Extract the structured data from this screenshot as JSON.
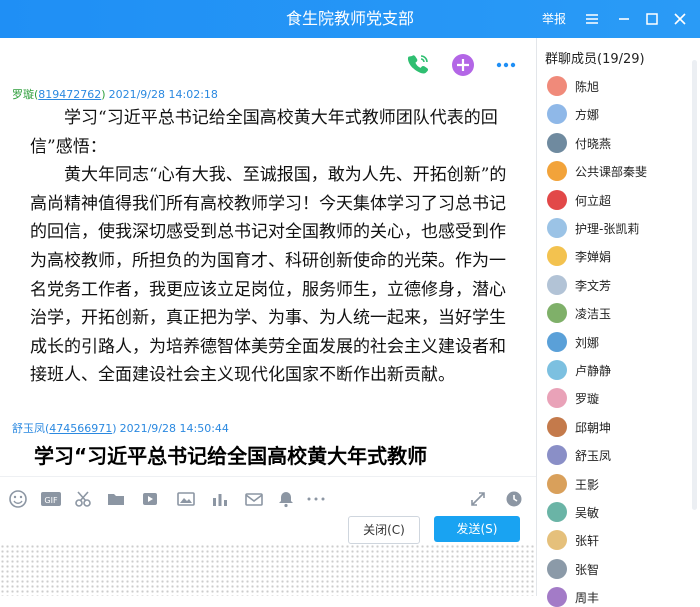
{
  "window": {
    "title": "食生院教师党支部",
    "report_label": "举报"
  },
  "messages": [
    {
      "sender": "罗璇",
      "qq": "819472762",
      "time": "2021/9/28 14:02:18",
      "paragraphs": [
        "学习“习近平总书记给全国高校黄大年式教师团队代表的回信”感悟：",
        "黄大年同志“心有大我、至诚报国，敢为人先、开拓创新”的高尚精神值得我们所有高校教师学习！今天集体学习了习总书记的回信，使我深切感受到总书记对全国教师的关心，也感受到作为高校教师，所担负的为国育才、科研创新使命的光荣。作为一名党务工作者，我更应该立足岗位，服务师生，立德修身，潜心治学，开拓创新，真正把为学、为事、为人统一起来，当好学生成长的引路人，为培养德智体美劳全面发展的社会主义建设者和接班人、全面建设社会主义现代化国家不断作出新贡献。"
      ]
    },
    {
      "sender": "舒玉凤",
      "qq": "474566971",
      "time": "2021/9/28 14:50:44",
      "preview": "学习“习近平总书记给全国高校黄大年式教师"
    }
  ],
  "buttons": {
    "close": "关闭(C)",
    "send": "发送(S)"
  },
  "members": {
    "title": "群聊成员(19/29)",
    "list": [
      "陈旭",
      "方娜",
      "付晓燕",
      "公共课部秦斐",
      "何立超",
      "护理-张凯莉",
      "李婵娟",
      "李文芳",
      "凌洁玉",
      "刘娜",
      "卢静静",
      "罗璇",
      "邱朝坤",
      "舒玉凤",
      "王影",
      "吴敏",
      "张轩",
      "张智",
      "周丰"
    ],
    "avatar_colors": [
      "#f08a7a",
      "#8fb8e8",
      "#6f8a9f",
      "#f2a33a",
      "#e24848",
      "#9bc3e6",
      "#f3c24f",
      "#b2c3d6",
      "#7fb069",
      "#5aa0d8",
      "#7cc0e0",
      "#e9a2b8",
      "#c47a4b",
      "#8a8fc7",
      "#d9a05b",
      "#6ab4a6",
      "#e5c07b",
      "#8b9aa8",
      "#a37bc7"
    ]
  },
  "toolbar_icons": [
    "emoji-icon",
    "gif-icon",
    "scissors-icon",
    "folder-icon",
    "music-icon",
    "image-icon",
    "chart-icon",
    "mail-icon",
    "bell-icon",
    "more-icon",
    "expand-icon",
    "history-icon"
  ],
  "colors": {
    "accent": "#1f8ff5",
    "send": "#19a3f2",
    "phone": "#2fbf71",
    "plus": "#b366e6"
  }
}
